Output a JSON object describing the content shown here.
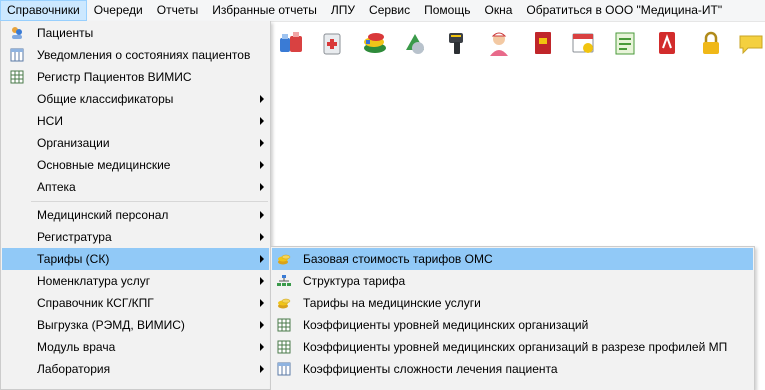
{
  "menubar": {
    "items": [
      {
        "label": "Справочники"
      },
      {
        "label": "Очереди"
      },
      {
        "label": "Отчеты"
      },
      {
        "label": "Избранные отчеты"
      },
      {
        "label": "ЛПУ"
      },
      {
        "label": "Сервис"
      },
      {
        "label": "Помощь"
      },
      {
        "label": "Окна"
      },
      {
        "label": "Обратиться в ООО \"Медицина-ИТ\""
      }
    ]
  },
  "toolbar": {
    "icons": [
      "medicines-icon",
      "medical-kit-icon",
      "pills-stack-icon",
      "capsule-icon",
      "barcode-scanner-icon",
      "nurse-icon",
      "red-book-icon",
      "calendar-icon",
      "notepad-icon",
      "pdf-icon",
      "lock-icon",
      "chat-icon"
    ]
  },
  "menu": {
    "items": [
      {
        "label": "Пациенты",
        "icon": "patients-icon"
      },
      {
        "label": "Уведомления о состояниях пациентов",
        "icon": "table-icon"
      },
      {
        "label": "Регистр Пациентов ВИМИС",
        "icon": "grid-icon"
      },
      {
        "label": "Общие классификаторы"
      },
      {
        "label": "НСИ"
      },
      {
        "label": "Организации"
      },
      {
        "label": "Основные медицинские"
      },
      {
        "label": "Аптека"
      },
      {
        "label": "Медицинский персонал"
      },
      {
        "label": "Регистратура"
      },
      {
        "label": "Тарифы (СК)"
      },
      {
        "label": "Номенклатура услуг"
      },
      {
        "label": "Справочник КСГ/КПГ"
      },
      {
        "label": "Выгрузка (РЭМД, ВИМИС)"
      },
      {
        "label": "Модуль врача"
      },
      {
        "label": "Лаборатория"
      }
    ]
  },
  "submenu": {
    "items": [
      {
        "label": "Базовая стоимость тарифов ОМС",
        "icon": "coins-icon"
      },
      {
        "label": "Структура тарифа",
        "icon": "hierarchy-icon"
      },
      {
        "label": "Тарифы на медицинские услуги",
        "icon": "coins-icon"
      },
      {
        "label": "Коэффициенты уровней медицинских организаций",
        "icon": "grid-icon"
      },
      {
        "label": "Коэффициенты уровней медицинских организаций в разрезе профилей МП",
        "icon": "grid-icon"
      },
      {
        "label": "Коэффициенты сложности лечения пациента",
        "icon": "table-icon"
      }
    ]
  },
  "colors": {
    "menu_bg": "#f2f2f2",
    "highlight": "#91c9f7",
    "submenu_highlight": "#91c9f7",
    "menubar_active": "#cce8ff"
  }
}
